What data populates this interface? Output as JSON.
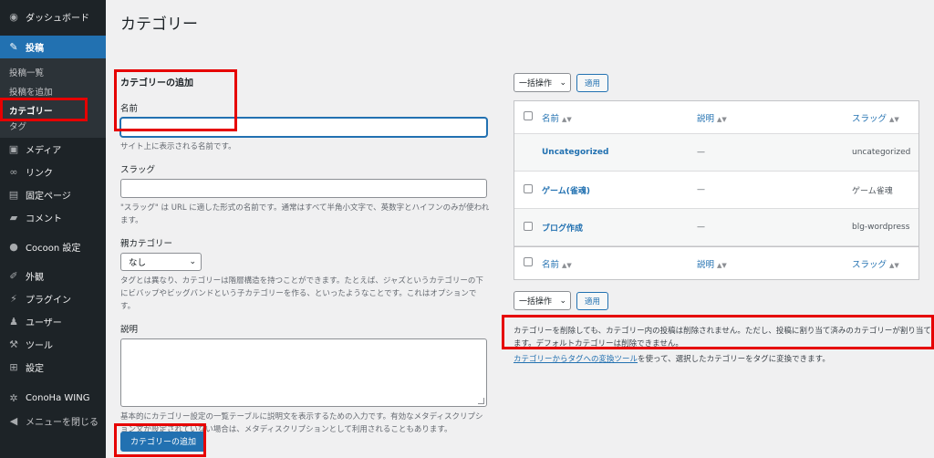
{
  "sidebar": {
    "dashboard": "ダッシュボード",
    "posts": "投稿",
    "submenu": [
      "投稿一覧",
      "投稿を追加",
      "カテゴリー",
      "タグ"
    ],
    "media": "メディア",
    "links": "リンク",
    "pages": "固定ページ",
    "comments": "コメント",
    "cocoon": "Cocoon 設定",
    "appearance": "外観",
    "plugins": "プラグイン",
    "users": "ユーザー",
    "tools": "ツール",
    "settings": "設定",
    "conoha": "ConoHa WING",
    "collapse": "メニューを閉じる"
  },
  "page": {
    "title": "カテゴリー"
  },
  "form": {
    "heading": "カテゴリーの追加",
    "name_label": "名前",
    "name_help": "サイト上に表示される名前です。",
    "slug_label": "スラッグ",
    "slug_help": "\"スラッグ\" は URL に適した形式の名前です。通常はすべて半角小文字で、英数字とハイフンのみが使われます。",
    "parent_label": "親カテゴリー",
    "parent_value": "なし",
    "parent_help": "タグとは異なり、カテゴリーは階層構造を持つことができます。たとえば、ジャズというカテゴリーの下にビバップやビッグバンドという子カテゴリーを作る、といったようなことです。これはオプションです。",
    "desc_label": "説明",
    "desc_help": "基本的にカテゴリー設定の一覧テーブルに説明文を表示するための入力です。有効なメタディスクリプション文が設定されていない場合は、メタディスクリプションとして利用されることもあります。",
    "submit": "カテゴリーの追加"
  },
  "table": {
    "bulk_label": "一括操作",
    "apply": "適用",
    "headers": {
      "name": "名前",
      "description": "説明",
      "slug": "スラッグ"
    },
    "rows": [
      {
        "name": "Uncategorized",
        "description": "—",
        "slug": "uncategorized"
      },
      {
        "name": "ゲーム(雀魂)",
        "description": "—",
        "slug": "ゲーム雀魂"
      },
      {
        "name": "ブログ作成",
        "description": "—",
        "slug": "blg-wordpress"
      }
    ]
  },
  "notice": {
    "text": "カテゴリーを削除しても、カテゴリー内の投稿は削除されません。ただし、投稿に割り当て済みのカテゴリーが割り当てられます。デフォルトカテゴリーは削除できません。",
    "link": "カテゴリーからタグへの変換ツール",
    "link_suffix": "を使って、選択したカテゴリーをタグに変換できます。"
  },
  "colors": {
    "accent": "#2271b1",
    "sidebar": "#1d2327",
    "highlight": "#e60000"
  }
}
